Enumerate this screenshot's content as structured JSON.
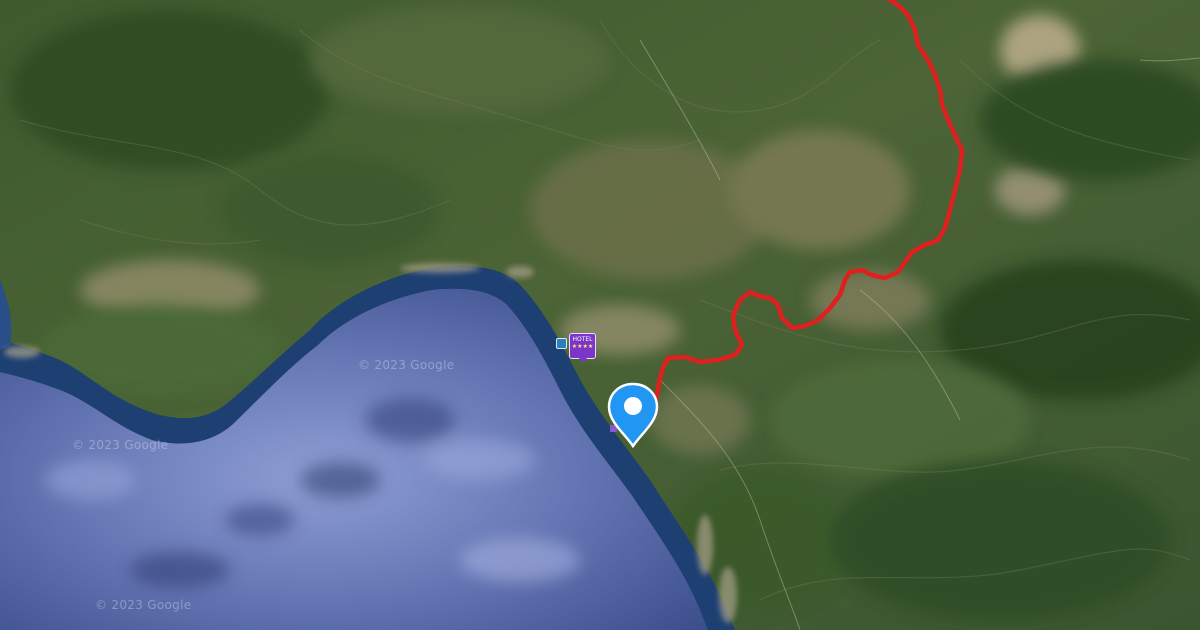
{
  "map": {
    "type": "satellite",
    "watermarks": [
      "© 2023 Google",
      "© 2023 Google",
      "© 2023 Google"
    ],
    "route": {
      "color": "#e01f1f"
    },
    "markers": {
      "hotel_label": "HOTEL",
      "hotel_stars": "★★★★",
      "hotel_icon": "hotel-icon",
      "location_icon": "map-pin-icon",
      "poi_icon": "poi-icon"
    },
    "colors": {
      "sea": "#5a6aa6",
      "coast": "#1a3c6b",
      "land": "#3d5a2c",
      "pin": "#2196f3"
    }
  }
}
